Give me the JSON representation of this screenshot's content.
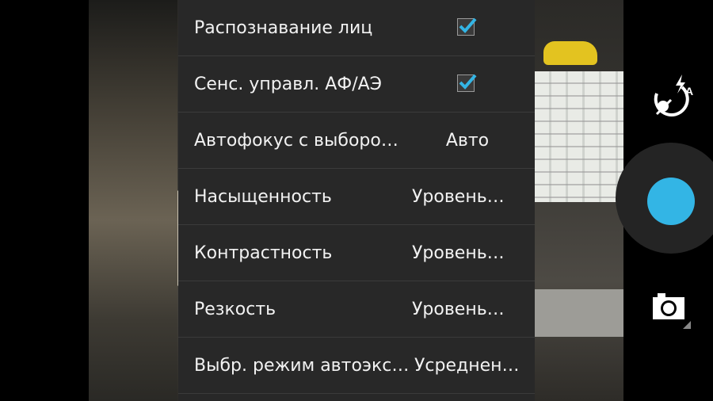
{
  "settings": {
    "items": [
      {
        "label": "Распознавание лиц",
        "type": "checkbox",
        "checked": true
      },
      {
        "label": "Сенс. управл. АФ/АЭ",
        "type": "checkbox",
        "checked": true
      },
      {
        "label": "Автофокус с выборо…",
        "type": "value",
        "value": "Авто"
      },
      {
        "label": "Насыщенность",
        "type": "value",
        "value": "Уровень…"
      },
      {
        "label": "Контрастность",
        "type": "value",
        "value": "Уровень…"
      },
      {
        "label": "Резкость",
        "type": "value",
        "value": "Уровень…"
      },
      {
        "label": "Выбр. режим автоэкс…",
        "type": "value",
        "value": "Усреднен…"
      }
    ],
    "accent_color": "#33b5e5"
  },
  "controls": {
    "flash_mode_badge": "A",
    "flash_icon": "flash-auto-icon",
    "shutter_icon": "shutter-button",
    "switch_icon": "camera-switch-icon"
  }
}
